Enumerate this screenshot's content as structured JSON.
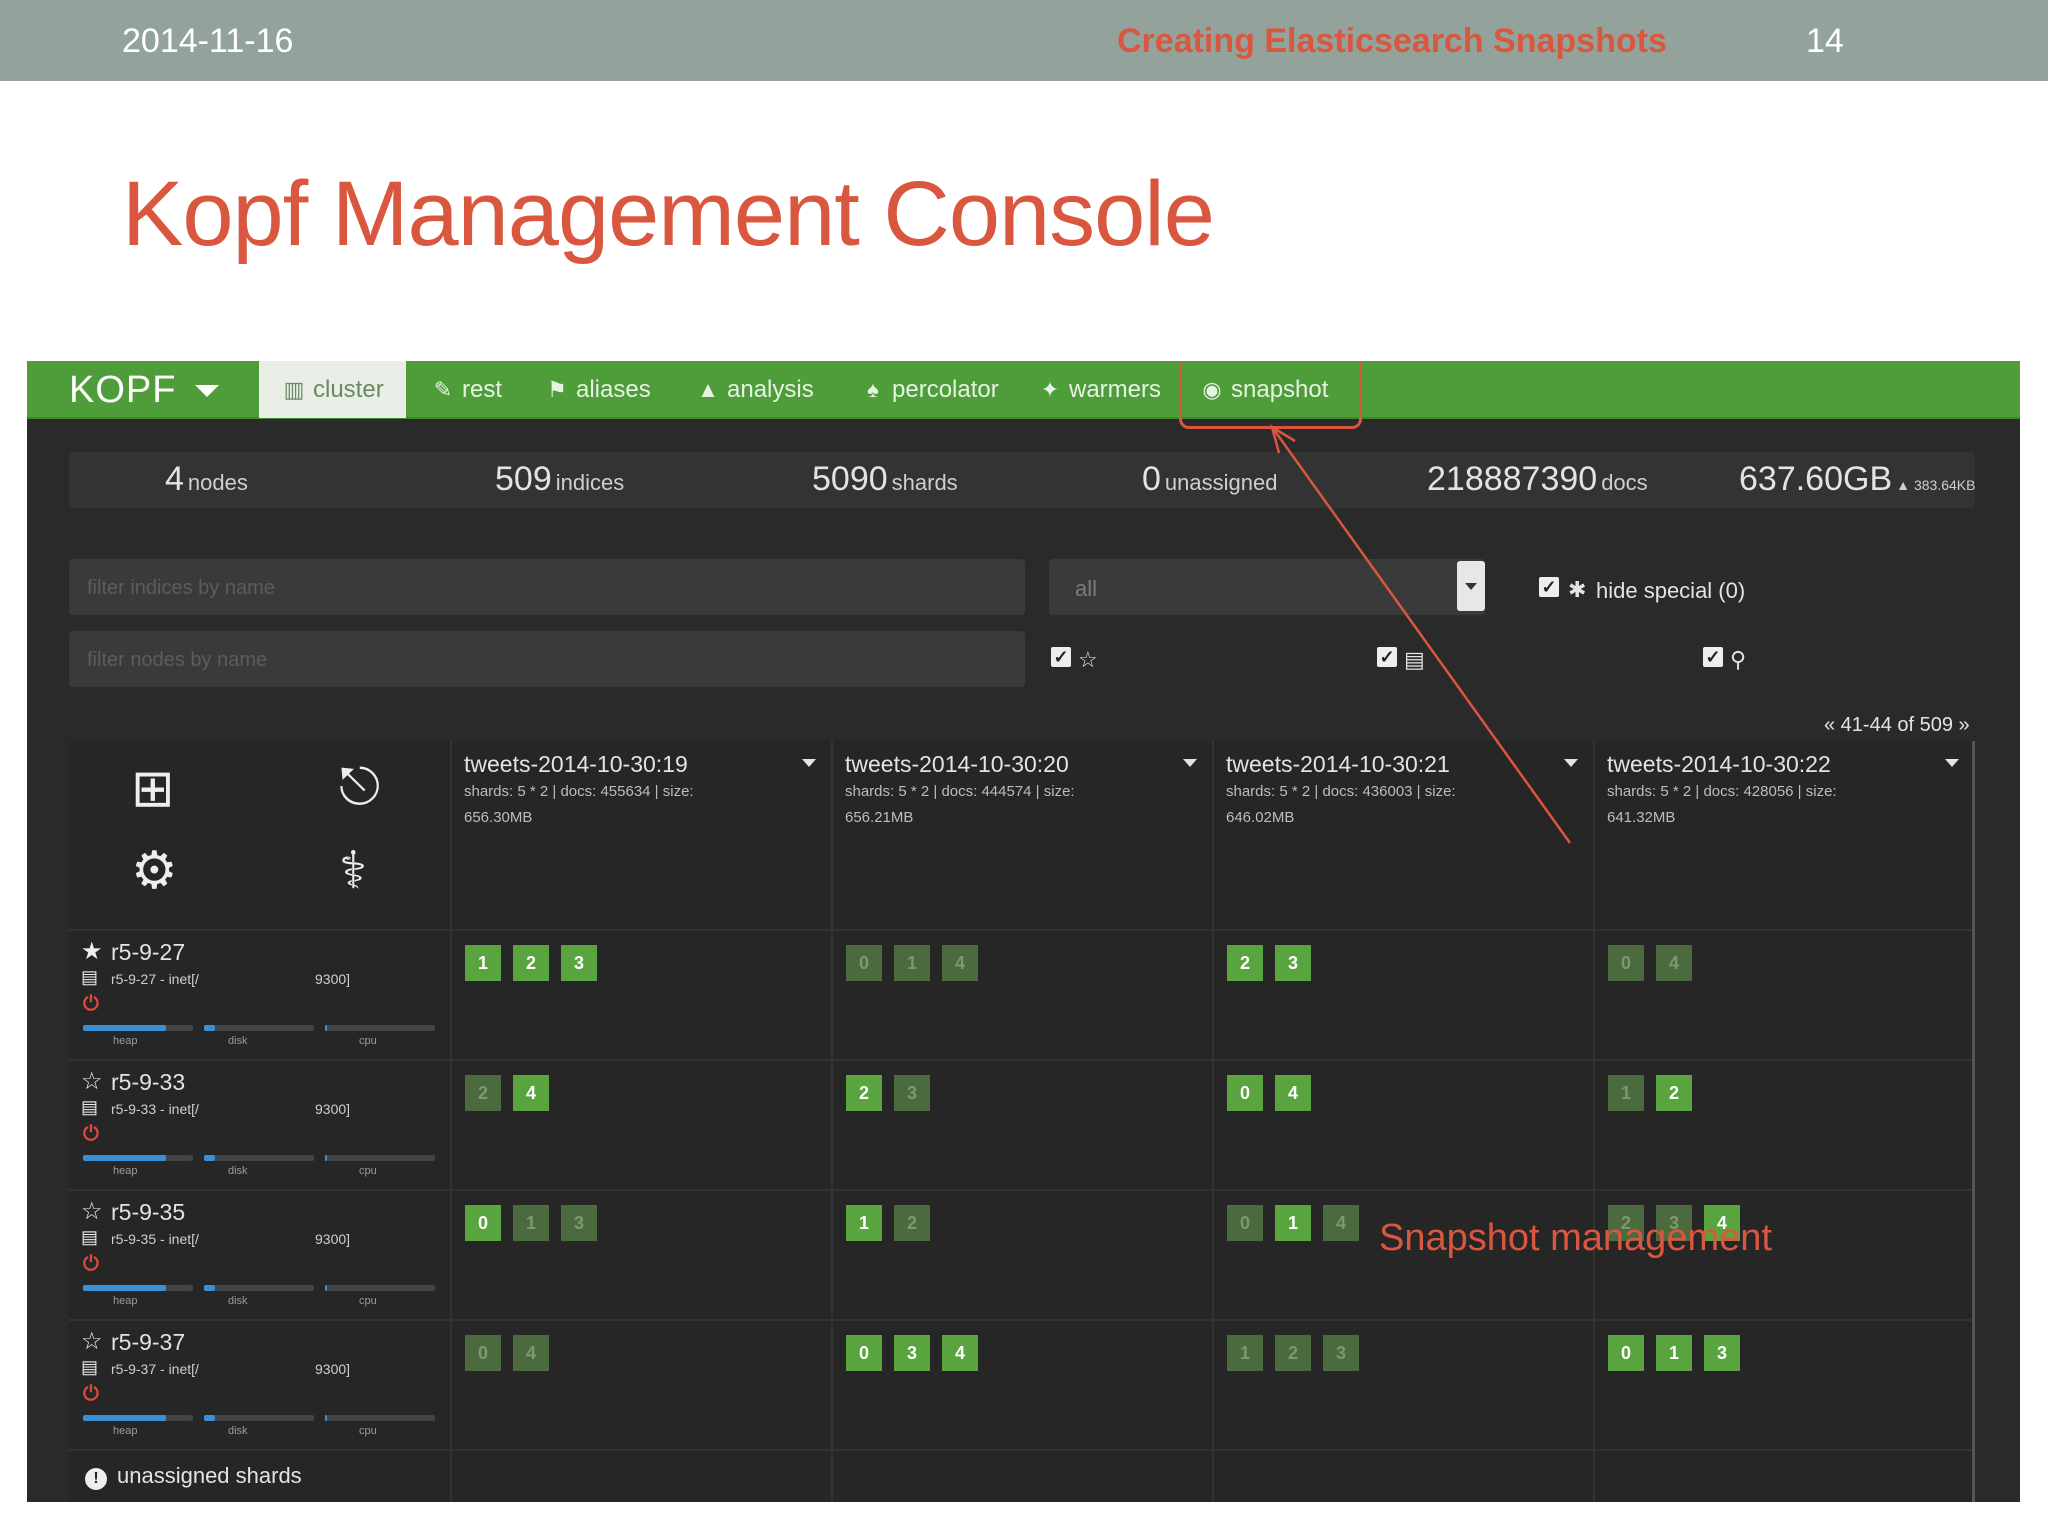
{
  "slide": {
    "date": "2014-11-16",
    "topic": "Creating Elasticsearch Snapshots",
    "page_number": "14",
    "title": "Kopf Management Console",
    "annotation": "Snapshot management"
  },
  "app": {
    "brand": "KOPF",
    "nav": [
      {
        "label": "cluster",
        "icon": "sitemap-icon",
        "active": true
      },
      {
        "label": "rest",
        "icon": "edit-icon"
      },
      {
        "label": "aliases",
        "icon": "tags-icon"
      },
      {
        "label": "analysis",
        "icon": "analysis-icon"
      },
      {
        "label": "percolator",
        "icon": "bell-icon"
      },
      {
        "label": "warmers",
        "icon": "fire-icon"
      },
      {
        "label": "snapshot",
        "icon": "camera-icon"
      }
    ],
    "stats": {
      "nodes": {
        "value": "4",
        "unit": "nodes"
      },
      "indices": {
        "value": "509",
        "unit": "indices"
      },
      "shards": {
        "value": "5090",
        "unit": "shards"
      },
      "unassigned": {
        "value": "0",
        "unit": "unassigned"
      },
      "docs": {
        "value": "218887390",
        "unit": "docs"
      },
      "size": {
        "value": "637.60GB",
        "delta": "383.64KB"
      }
    },
    "filters": {
      "indices_placeholder": "filter indices by name",
      "nodes_placeholder": "filter nodes by name",
      "select_value": "all",
      "hide_special": "hide special (0)"
    },
    "pager": "« 41-44 of 509 »",
    "indices": [
      {
        "name": "tweets-2014-10-30:19",
        "meta": "shards: 5 * 2 | docs: 455634 | size: 656.30MB"
      },
      {
        "name": "tweets-2014-10-30:20",
        "meta": "shards: 5 * 2 | docs: 444574 | size: 656.21MB"
      },
      {
        "name": "tweets-2014-10-30:21",
        "meta": "shards: 5 * 2 | docs: 436003 | size: 646.02MB"
      },
      {
        "name": "tweets-2014-10-30:22",
        "meta": "shards: 5 * 2 | docs: 428056 | size: 641.32MB"
      }
    ],
    "nodes": [
      {
        "name": "r5-9-27",
        "host": "r5-9-27 - inet[/",
        "port": "9300]",
        "master": true,
        "heap": 0.75,
        "disk": 0.1,
        "cpu": 0.02
      },
      {
        "name": "r5-9-33",
        "host": "r5-9-33 - inet[/",
        "port": "9300]",
        "master": false,
        "heap": 0.75,
        "disk": 0.1,
        "cpu": 0.02
      },
      {
        "name": "r5-9-35",
        "host": "r5-9-35 - inet[/",
        "port": "9300]",
        "master": false,
        "heap": 0.75,
        "disk": 0.1,
        "cpu": 0.02
      },
      {
        "name": "r5-9-37",
        "host": "r5-9-37 - inet[/",
        "port": "9300]",
        "master": false,
        "heap": 0.75,
        "disk": 0.1,
        "cpu": 0.02
      }
    ],
    "bar_labels": {
      "heap": "heap",
      "disk": "disk",
      "cpu": "cpu"
    },
    "shards": [
      [
        [
          {
            "n": "1",
            "p": true
          },
          {
            "n": "2",
            "p": true
          },
          {
            "n": "3",
            "p": true
          }
        ],
        [
          {
            "n": "0",
            "p": false
          },
          {
            "n": "1",
            "p": false
          },
          {
            "n": "4",
            "p": false
          }
        ],
        [
          {
            "n": "2",
            "p": true
          },
          {
            "n": "3",
            "p": true
          }
        ],
        [
          {
            "n": "0",
            "p": false
          },
          {
            "n": "4",
            "p": false
          }
        ]
      ],
      [
        [
          {
            "n": "2",
            "p": false
          },
          {
            "n": "4",
            "p": true
          }
        ],
        [
          {
            "n": "2",
            "p": true
          },
          {
            "n": "3",
            "p": false
          }
        ],
        [
          {
            "n": "0",
            "p": true
          },
          {
            "n": "4",
            "p": true
          }
        ],
        [
          {
            "n": "1",
            "p": false
          },
          {
            "n": "2",
            "p": true
          }
        ]
      ],
      [
        [
          {
            "n": "0",
            "p": true
          },
          {
            "n": "1",
            "p": false
          },
          {
            "n": "3",
            "p": false
          }
        ],
        [
          {
            "n": "1",
            "p": true
          },
          {
            "n": "2",
            "p": false
          }
        ],
        [
          {
            "n": "0",
            "p": false
          },
          {
            "n": "1",
            "p": true
          },
          {
            "n": "4",
            "p": false
          }
        ],
        [
          {
            "n": "2",
            "p": false
          },
          {
            "n": "3",
            "p": false
          },
          {
            "n": "4",
            "p": true
          }
        ]
      ],
      [
        [
          {
            "n": "0",
            "p": false
          },
          {
            "n": "4",
            "p": false
          }
        ],
        [
          {
            "n": "0",
            "p": true
          },
          {
            "n": "3",
            "p": true
          },
          {
            "n": "4",
            "p": true
          }
        ],
        [
          {
            "n": "1",
            "p": false
          },
          {
            "n": "2",
            "p": false
          },
          {
            "n": "3",
            "p": false
          }
        ],
        [
          {
            "n": "0",
            "p": true
          },
          {
            "n": "1",
            "p": true
          },
          {
            "n": "3",
            "p": true
          }
        ]
      ]
    ],
    "unassigned_label": "unassigned shards"
  },
  "colors": {
    "accent": "#d9573e",
    "navbar": "#4f9d3a",
    "primary_shard": "#5aa43f",
    "replica_shard": "#4b6a3e",
    "background": "#2a2a2a"
  }
}
